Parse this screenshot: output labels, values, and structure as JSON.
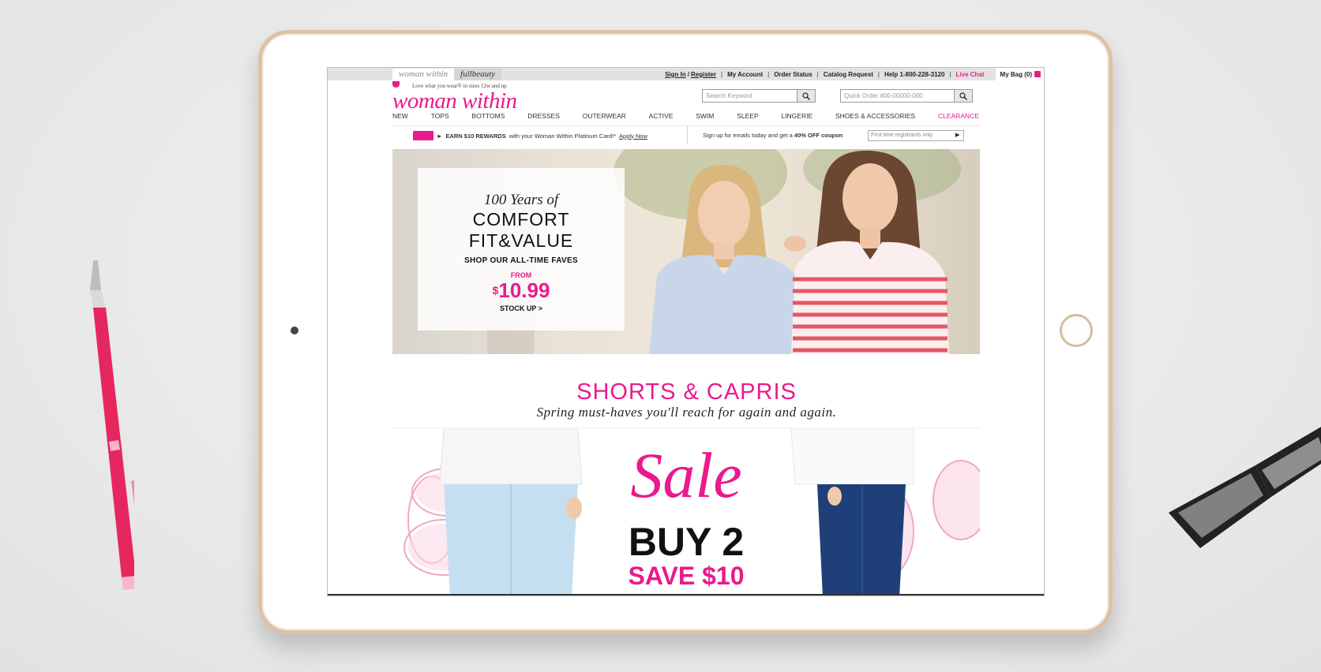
{
  "colors": {
    "brand_pink": "#ea1a8c",
    "tablet_frame": "#dcc3a6",
    "util_bar": "#e2e2e2"
  },
  "brand_tabs": [
    "woman within",
    "fullbeauty"
  ],
  "util_links": {
    "sign_in": "Sign In",
    "slash": "/",
    "register": "Register",
    "my_account": "My Account",
    "order_status": "Order Status",
    "catalog_request": "Catalog Request",
    "help": "Help 1-800-228-3120",
    "live_chat": "Live Chat",
    "bag": "My Bag (0)"
  },
  "header": {
    "tagline": "Love what you wear® in sizes 12w and up",
    "logo": "woman within",
    "search_placeholder": "Search Keyword",
    "quick_order_placeholder": "Quick Order #00-00000-000"
  },
  "nav": [
    "NEW",
    "TOPS",
    "BOTTOMS",
    "DRESSES",
    "OUTERWEAR",
    "ACTIVE",
    "SWIM",
    "SLEEP",
    "LINGERIE",
    "SHOES & ACCESSORIES",
    "CLEARANCE"
  ],
  "promo": {
    "arrow": "►",
    "bold": "EARN $10 REWARDS",
    "text": "with your Woman Within Platinum Card!*",
    "link": "Apply Now"
  },
  "email_promo": {
    "text": "Sign up for emails today and get a",
    "bold": "40% OFF coupon",
    "placeholder": "First time registrants only",
    "go": "▶"
  },
  "hero": {
    "years": "100 Years of",
    "line1": "COMFORT",
    "line2": "FIT&VALUE",
    "shop": "SHOP OUR ALL-TIME FAVES",
    "from": "FROM",
    "currency": "$",
    "price": "10.99",
    "cta": "STOCK UP >"
  },
  "section": {
    "title": "SHORTS & CAPRIS",
    "subtitle": "Spring must-haves you'll reach for again and again."
  },
  "sale": {
    "word": "Sale",
    "buy": "BUY 2",
    "save": "SAVE $10"
  }
}
